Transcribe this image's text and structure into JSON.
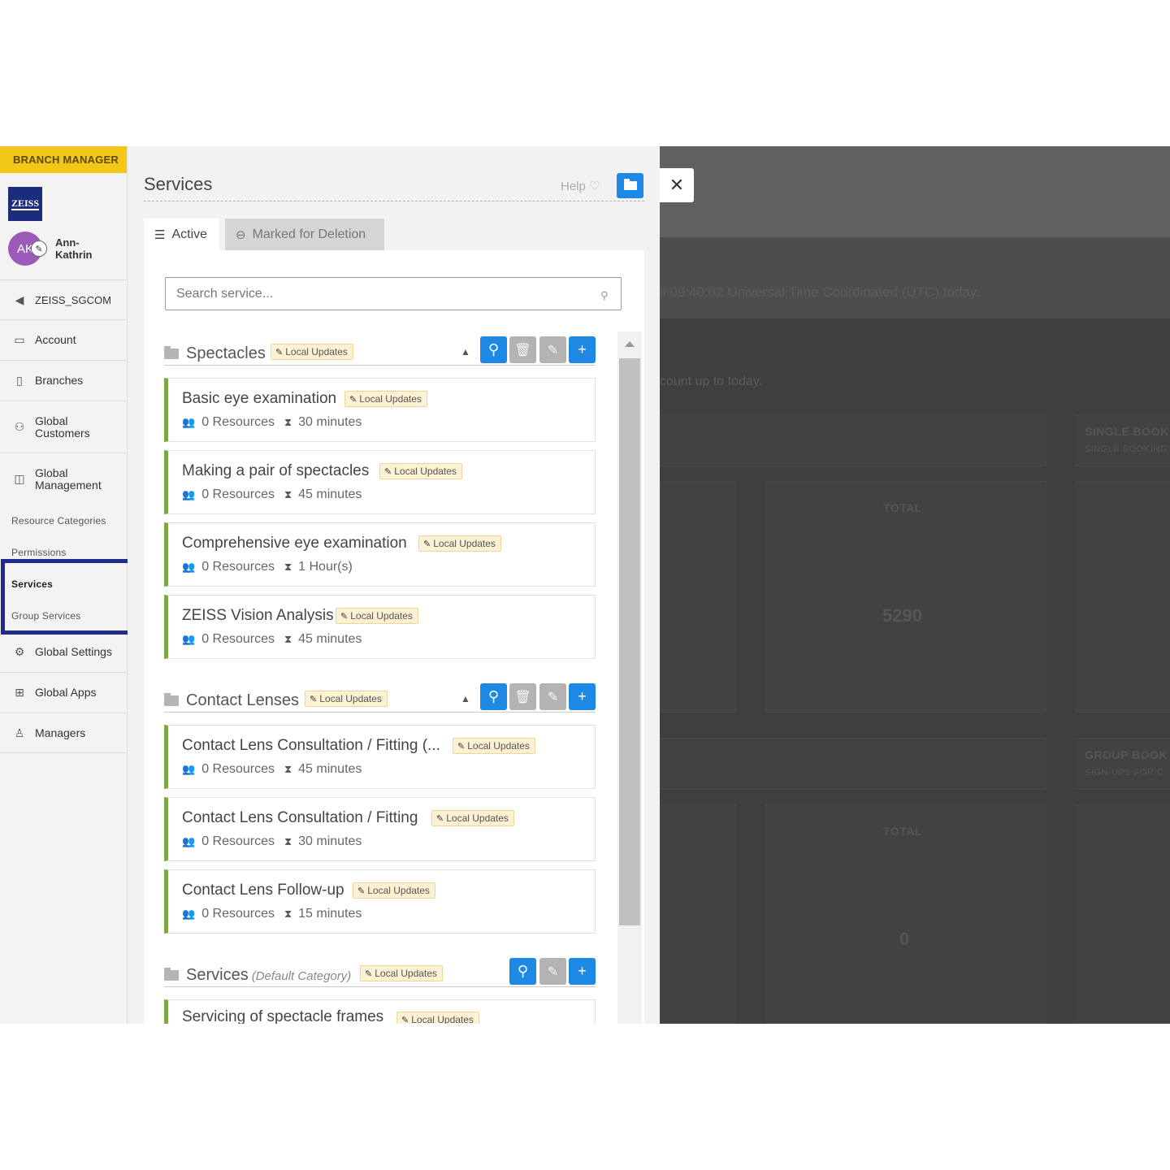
{
  "sidebar": {
    "role": "BRANCH MANAGER",
    "logo_text": "ZEISS",
    "user_initials": "AK",
    "user_name": "Ann-Kathrin",
    "items": [
      {
        "label": "ZEISS_SGCOM",
        "icon": "arrow-left-circle-icon"
      },
      {
        "label": "Account",
        "icon": "briefcase-icon"
      },
      {
        "label": "Branches",
        "icon": "building-icon"
      },
      {
        "label": "Global Customers",
        "icon": "users-icon"
      },
      {
        "label": "Global Management",
        "icon": "management-icon"
      },
      {
        "label": "Global Settings",
        "icon": "settings-icon"
      },
      {
        "label": "Global Apps",
        "icon": "apps-grid-icon"
      },
      {
        "label": "Managers",
        "icon": "managers-icon"
      }
    ],
    "subitems": [
      "Resource Categories",
      "Permissions",
      "Services",
      "Group Services"
    ]
  },
  "panel": {
    "title": "Services",
    "help": "Help",
    "tabs": {
      "active": "Active",
      "deleted": "Marked for Deletion"
    },
    "search_placeholder": "Search service..."
  },
  "badge_label": "Local Updates",
  "categories": [
    {
      "name": "Spectacles",
      "services": [
        {
          "name": "Basic eye examination",
          "resources": "0 Resources",
          "duration": "30 minutes"
        },
        {
          "name": "Making a pair of spectacles",
          "resources": "0 Resources",
          "duration": "45 minutes"
        },
        {
          "name": "Comprehensive eye examination",
          "resources": "0 Resources",
          "duration": "1 Hour(s)"
        },
        {
          "name": "ZEISS Vision Analysis",
          "resources": "0 Resources",
          "duration": "45 minutes"
        }
      ]
    },
    {
      "name": "Contact Lenses",
      "services": [
        {
          "name": "Contact Lens Consultation / Fitting (...",
          "resources": "0 Resources",
          "duration": "45 minutes"
        },
        {
          "name": "Contact Lens Consultation / Fitting",
          "resources": "0 Resources",
          "duration": "30 minutes"
        },
        {
          "name": "Contact Lens Follow-up",
          "resources": "0 Resources",
          "duration": "15 minutes"
        }
      ]
    },
    {
      "name": "Services",
      "suffix": "(Default Category)",
      "services": [
        {
          "name": "Servicing of spectacle frames"
        }
      ]
    }
  ],
  "backdrop": {
    "notice": "il 09:40:02 Universal Time Coordinated (UTC) today.",
    "subnotice": "count up to today.",
    "single_booking": "SINGLE BOOK",
    "single_booking_sub": "SINGLE BOOKING",
    "group_booking": "GROUP BOOK",
    "group_booking_sub": "SIGN-UPS FOR C",
    "total_label": "TOTAL",
    "total_single": "5290",
    "total_group": "0"
  },
  "colors": {
    "role_banner": "#f2c718",
    "accent_blue": "#1e88e5",
    "service_border": "#7ca745",
    "highlight_box": "#1f2a8c",
    "badge_bg": "#fdf1d4"
  }
}
